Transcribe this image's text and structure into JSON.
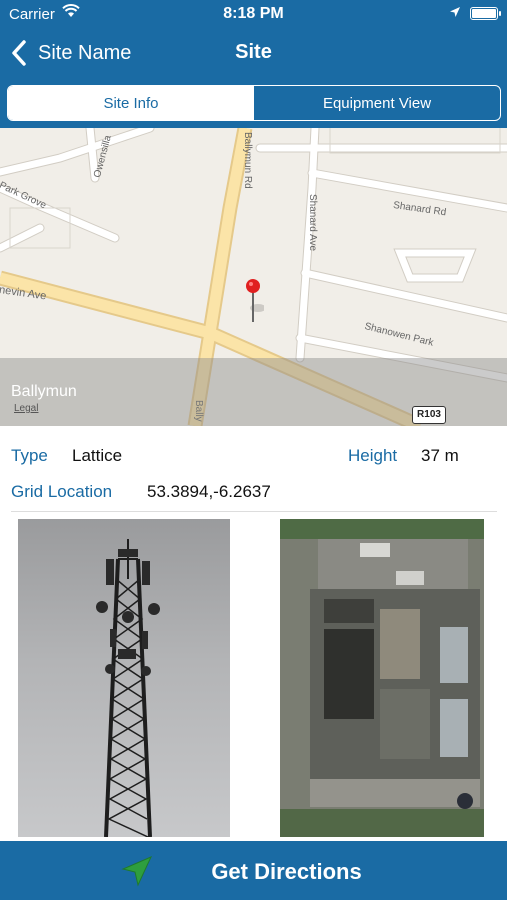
{
  "status_bar": {
    "carrier": "Carrier",
    "time": "8:18 PM"
  },
  "nav": {
    "back_label": "Site Name",
    "title": "Site"
  },
  "tabs": [
    {
      "label": "Site Info",
      "active": true
    },
    {
      "label": "Equipment View",
      "active": false
    }
  ],
  "map": {
    "place_name": "Ballymun",
    "legal": "Legal",
    "roads": [
      "Ballymun Rd",
      "Owensilla",
      "Park Grove",
      "nevin Ave",
      "Shanard Ave",
      "Shanard Rd",
      "Shanowen Park",
      "Bally"
    ],
    "route_shield": "R103"
  },
  "site": {
    "type_label": "Type",
    "type_value": "Lattice",
    "height_label": "Height",
    "height_value": "37 m",
    "grid_label": "Grid Location",
    "grid_value": "53.3894,-6.2637"
  },
  "action": {
    "label": "Get Directions"
  },
  "colors": {
    "primary": "#1a6ba4",
    "accent_arrow": "#2e9e3e",
    "pin": "#e02020"
  }
}
